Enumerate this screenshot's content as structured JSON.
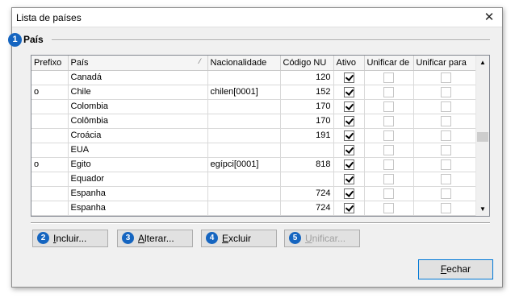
{
  "window": {
    "title": "Lista de países",
    "close_glyph": "✕"
  },
  "group": {
    "badge": "1",
    "title": "País"
  },
  "grid": {
    "columns": [
      "Prefixo",
      "País",
      "Nacionalidade",
      "Código NU",
      "Ativo",
      "Unificar de",
      "Unificar para"
    ],
    "sort_indicator": "⁄",
    "rows": [
      {
        "prefix": "",
        "country": "Canadá",
        "nationality": "",
        "code": "120",
        "active": true
      },
      {
        "prefix": "o",
        "country": "Chile",
        "nationality": "chilen[0001]",
        "code": "152",
        "active": true
      },
      {
        "prefix": "",
        "country": "Colombia",
        "nationality": "",
        "code": "170",
        "active": true
      },
      {
        "prefix": "",
        "country": "Colômbia",
        "nationality": "",
        "code": "170",
        "active": true
      },
      {
        "prefix": "",
        "country": "Croácia",
        "nationality": "",
        "code": "191",
        "active": true
      },
      {
        "prefix": "",
        "country": "EUA",
        "nationality": "",
        "code": "",
        "active": true
      },
      {
        "prefix": "o",
        "country": "Egito",
        "nationality": "egípci[0001]",
        "code": "818",
        "active": true
      },
      {
        "prefix": "",
        "country": "Equador",
        "nationality": "",
        "code": "",
        "active": true
      },
      {
        "prefix": "",
        "country": "Espanha",
        "nationality": "",
        "code": "724",
        "active": true
      },
      {
        "prefix": "",
        "country": "Espanha",
        "nationality": "",
        "code": "724",
        "active": true
      }
    ],
    "scroll_up": "▲",
    "scroll_down": "▼"
  },
  "buttons": {
    "include": {
      "badge": "2",
      "label_u": "I",
      "label_rest": "ncluir..."
    },
    "edit": {
      "badge": "3",
      "label_u": "A",
      "label_rest": "lterar..."
    },
    "delete": {
      "badge": "4",
      "label_u": "E",
      "label_rest": "xcluir"
    },
    "merge": {
      "badge": "5",
      "label_u": "U",
      "label_rest": "nificar..."
    },
    "close": {
      "label_u": "F",
      "label_rest": "echar"
    }
  },
  "colors": {
    "badge": "#1565c0",
    "focus_border": "#0078d7"
  }
}
